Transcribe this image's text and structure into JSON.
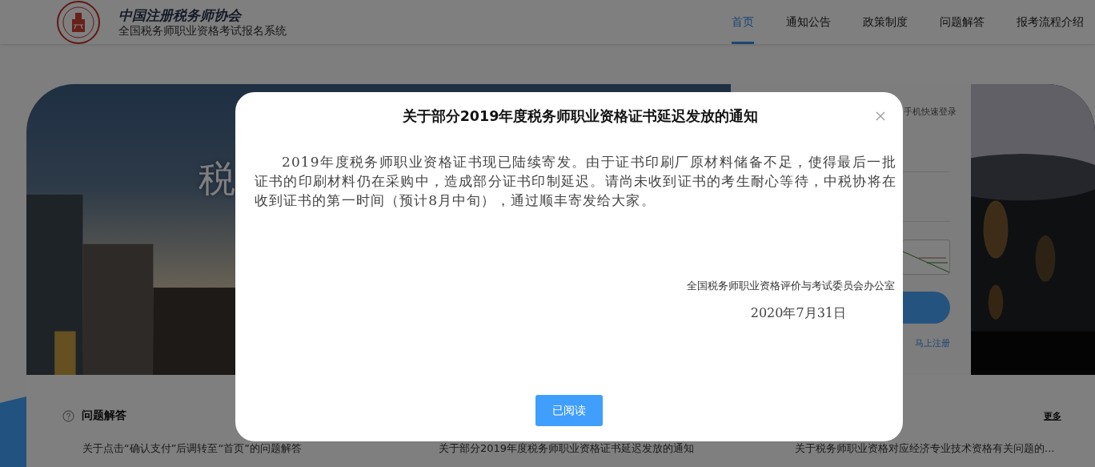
{
  "header": {
    "logo_calligraphy": "中国注册税务师协会",
    "subtitle": "全国税务师职业资格考试报名系统",
    "nav": [
      {
        "label": "首页",
        "selected": true
      },
      {
        "label": "通知公告",
        "selected": false
      },
      {
        "label": "政策制度",
        "selected": false
      },
      {
        "label": "问题解答",
        "selected": false
      },
      {
        "label": "报考流程介绍",
        "selected": false
      }
    ]
  },
  "hero": {
    "slogan": "税",
    "login": {
      "tab": "手机快速登录",
      "register_link": "马上注册"
    }
  },
  "faq": {
    "title": "问题解答",
    "more": "更多",
    "items": [
      "关于点击“确认支付”后调转至“首页”的问题解答",
      "关于部分2019年度税务师职业资格证书延迟发放的通知",
      "关于税务师职业资格对应经济专业技术资格有关问题的..."
    ]
  },
  "dialog": {
    "title": "关于部分2019年度税务师职业资格证书延迟发放的通知",
    "paragraph": "2019年度税务师职业资格证书现已陆续寄发。由于证书印刷厂原材料储备不足，使得最后一批证书的印刷材料仍在采购中，造成部分证书印制延迟。请尚未收到证书的考生耐心等待，中税协将在收到证书的第一时间（预计8月中旬），通过顺丰寄发给大家。",
    "signature": "全国税务师职业资格评价与考试委员会办公室",
    "date": "2020年7月31日",
    "button": "已阅读"
  }
}
